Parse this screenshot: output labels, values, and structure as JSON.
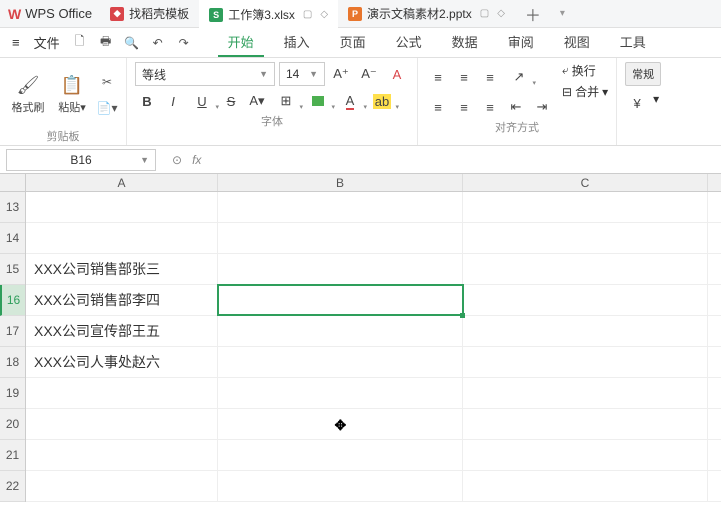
{
  "app": {
    "name": "WPS Office"
  },
  "tabs": [
    {
      "label": "找稻壳模板",
      "icon": "red"
    },
    {
      "label": "工作簿3.xlsx",
      "icon": "green",
      "active": true
    },
    {
      "label": "演示文稿素材2.pptx",
      "icon": "orange"
    }
  ],
  "menu": {
    "file": "文件",
    "items": [
      "开始",
      "插入",
      "页面",
      "公式",
      "数据",
      "审阅",
      "视图",
      "工具"
    ],
    "active": "开始"
  },
  "ribbon": {
    "clipboard": {
      "format_painter": "格式刷",
      "paste": "粘贴",
      "group": "剪贴板"
    },
    "font": {
      "family": "等线",
      "size": "14",
      "group": "字体",
      "bold": "B",
      "italic": "I",
      "underline": "U",
      "strike": "S"
    },
    "align": {
      "wrap": "换行",
      "merge": "合并",
      "group": "对齐方式"
    },
    "style": {
      "const": "常规",
      "yen": "¥"
    }
  },
  "namebox": "B16",
  "fx": "fx",
  "columns": [
    "A",
    "B",
    "C"
  ],
  "rows": [
    13,
    14,
    15,
    16,
    17,
    18,
    19,
    20,
    21,
    22
  ],
  "active_row": 16,
  "active_cell": "B16",
  "cells": {
    "A15": "XXX公司销售部张三",
    "A16": "XXX公司销售部李四",
    "A17": "XXX公司宣传部王五",
    "A18": "XXX公司人事处赵六"
  },
  "cursor_pos": {
    "col": "B",
    "row": 20,
    "glyph": "✥"
  }
}
